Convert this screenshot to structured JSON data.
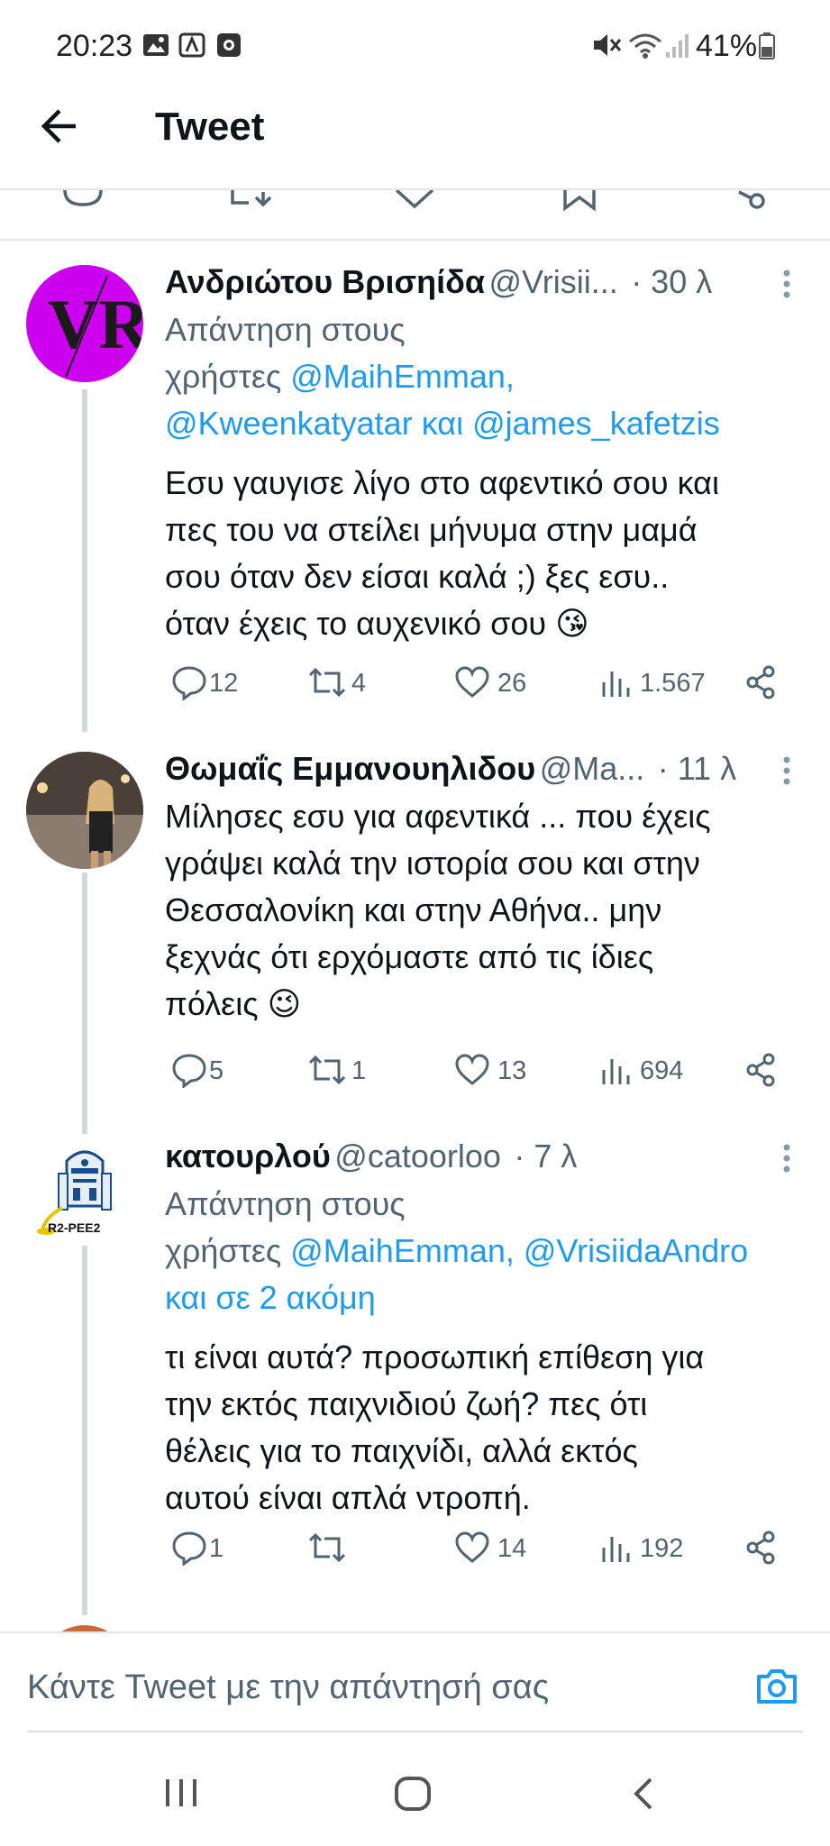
{
  "status_bar": {
    "time": "20:23",
    "battery": "41%"
  },
  "header": {
    "title": "Tweet"
  },
  "tweets": [
    {
      "author_name": "Ανδριώτου Βρισηίδα",
      "handle": "@Vrisii...",
      "time": "· 30 λ",
      "reply_prefix_line1": "Απάντηση στους",
      "reply_prefix_line2": "χρήστες",
      "mention1": "@MaihEmman,",
      "mention2": "@Kweenkatyatar",
      "reply_and": "και",
      "mention3": "@james_kafetzis",
      "body_lines": [
        "Εσυ γαυγισε λίγο στο αφεντικό σου και",
        "πες του να στείλει μήνυμα στην μαμά",
        "σου όταν δεν είσαι καλά  ;) ξες εσυ..",
        "όταν έχεις το αυχενικό σου 😘"
      ],
      "replies": "12",
      "retweets": "4",
      "likes": "26",
      "views": "1.567"
    },
    {
      "author_name": "Θωμαΐς Εμμανουηλιδου",
      "handle": "@Ma...",
      "time": "· 11 λ",
      "body_lines": [
        "Μίλησες εσυ για αφεντικά ... που έχεις",
        "γράψει καλά την ιστορία σου και στην",
        "Θεσσαλονίκη και στην Αθήνα.. μην",
        "ξεχνάς ότι ερχόμαστε από τις ίδιες",
        "πόλεις 😉"
      ],
      "replies": "5",
      "retweets": "1",
      "likes": "13",
      "views": "694"
    },
    {
      "author_name": "κατουρλού",
      "handle": "@catoorloo",
      "time": "· 7 λ",
      "avatar_caption": "R2-PEE2",
      "reply_prefix_line1": "Απάντηση στους",
      "reply_prefix_line2": "χρήστες",
      "mention1": "@MaihEmman,",
      "mention2": "@VrisiidaAndro",
      "mention3": "και σε 2 ακόμη",
      "body_lines": [
        "τι είναι αυτά? προσωπική επίθεση για",
        "την εκτός παιχνιδιού ζωή? πες ότι",
        "θέλεις για το παιχνίδι, αλλά εκτός",
        "αυτού είναι απλά ντροπή."
      ],
      "replies": "1",
      "retweets": "",
      "likes": "14",
      "views": "192"
    }
  ],
  "compose": {
    "placeholder": "Κάντε Tweet με την απάντησή σας"
  },
  "colors": {
    "link": "#1d9bf0",
    "muted": "#536471",
    "text": "#0f1419",
    "avatar1_bg": "#cc00ee"
  },
  "icons": [
    "back-arrow-icon",
    "reply-icon",
    "retweet-icon",
    "like-icon",
    "views-icon",
    "share-icon",
    "bookmark-icon",
    "more-icon",
    "camera-icon",
    "image-icon",
    "mute-icon",
    "wifi-icon",
    "signal-icon",
    "battery-icon"
  ]
}
